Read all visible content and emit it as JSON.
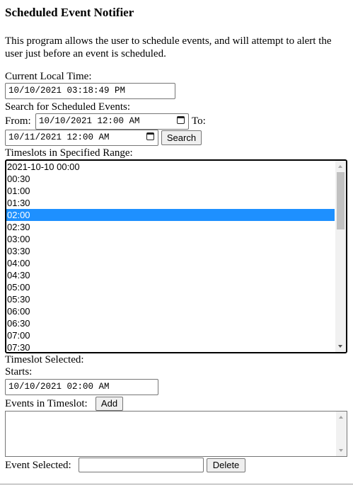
{
  "title": "Scheduled Event Notifier",
  "description": "This program allows the user to schedule events, and will attempt to alert the user just before an event is scheduled.",
  "current_time": {
    "label": "Current Local Time:",
    "value": "10/10/2021 03:18:49 PM"
  },
  "search": {
    "label": "Search for Scheduled Events:",
    "from_label": "From:",
    "from_value": "10/10/2021 12:00 AM",
    "to_label": "To:",
    "to_value": "10/11/2021 12:00 AM",
    "button": "Search"
  },
  "timeslots": {
    "label": "Timeslots in Specified Range:",
    "items": [
      "2021-10-10 00:00",
      "00:30",
      "01:00",
      "01:30",
      "02:00",
      "02:30",
      "03:00",
      "03:30",
      "04:00",
      "04:30",
      "05:00",
      "05:30",
      "06:00",
      "06:30",
      "07:00",
      "07:30"
    ],
    "selected_index": 4
  },
  "selected_slot": {
    "label": "Timeslot Selected:",
    "starts_label": "Starts:",
    "starts_value": "10/10/2021 02:00 AM"
  },
  "events": {
    "label": "Events in Timeslot:",
    "add_button": "Add"
  },
  "event_selected": {
    "label": "Event Selected:",
    "value": "",
    "delete_button": "Delete"
  }
}
